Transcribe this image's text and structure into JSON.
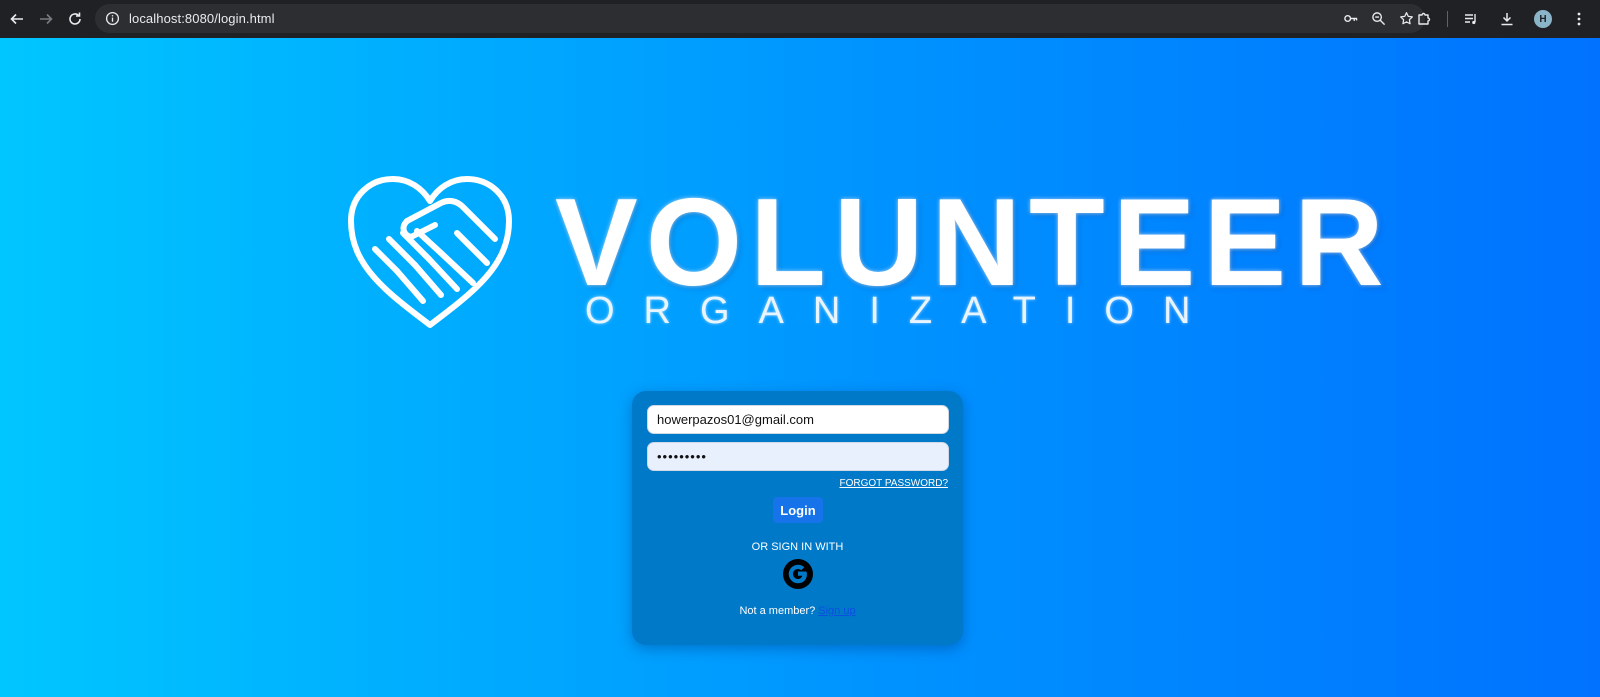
{
  "browser": {
    "url": "localhost:8080/login.html",
    "profile_initial": "H"
  },
  "icons": {
    "back": "arrow-left-icon",
    "forward": "arrow-right-icon",
    "reload": "reload-icon",
    "site_info": "info-icon",
    "password": "key-icon",
    "zoom": "zoom-icon",
    "bookmark": "star-icon",
    "extensions": "puzzle-icon",
    "media": "media-queue-icon",
    "download": "download-icon",
    "menu": "kebab-menu-icon"
  },
  "logo": {
    "title": "VOLUNTEER",
    "subtitle": "ORGANIZATION"
  },
  "login_form": {
    "email_value": "howerpazos01@gmail.com",
    "password_value": "•••••••••",
    "forgot_label": "FORGOT PASSWORD?",
    "login_label": "Login",
    "or_label": "OR SIGN IN WITH",
    "member_prompt": "Not a member?",
    "signup_label": "Sign up"
  },
  "colors": {
    "gradient_start": "#00c6ff",
    "gradient_end": "#0072ff",
    "card": "#0079c8",
    "button": "#1673ea"
  }
}
